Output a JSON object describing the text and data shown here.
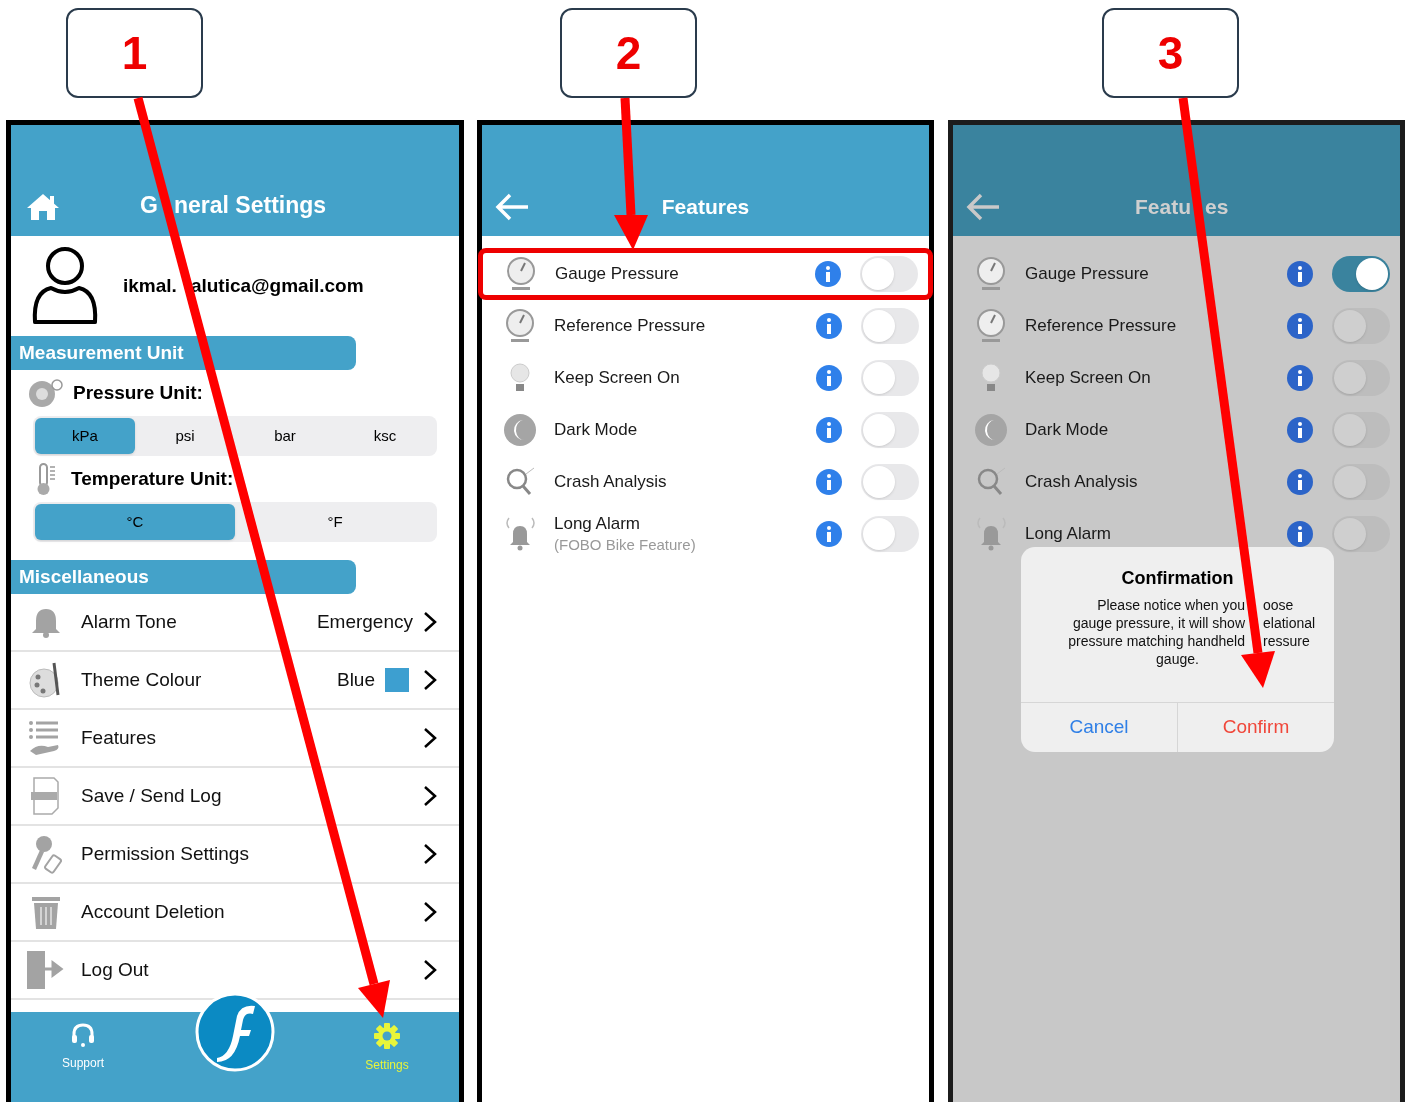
{
  "callouts": [
    {
      "label": "1"
    },
    {
      "label": "2"
    },
    {
      "label": "3"
    }
  ],
  "general_settings": {
    "title": [
      "G",
      "neral Settings"
    ],
    "email": [
      "ikmal.",
      "alutica@gmail.com"
    ],
    "measurement_header": "Measurement Unit",
    "pressure_label": "Pressure Unit:",
    "pressure_units": [
      {
        "label": "kPa",
        "selected": true
      },
      {
        "label": "psi",
        "selected": false
      },
      {
        "label": "bar",
        "selected": false
      },
      {
        "label": "ksc",
        "selected": false
      }
    ],
    "temperature_label": "Temperature Unit:",
    "temperature_units": [
      {
        "label": "°C",
        "selected": true
      },
      {
        "label": "°F",
        "selected": false
      }
    ],
    "misc_header": "Miscellaneous",
    "menu": [
      {
        "label": "Alarm Tone",
        "value": "Emergency"
      },
      {
        "label": "Theme Colour",
        "value": "Blue",
        "color": "#3d9fd0"
      },
      {
        "label": "Features"
      },
      {
        "label": "Save / Send Log"
      },
      {
        "label": "Permission Settings"
      },
      {
        "label": "Account Deletion"
      },
      {
        "label": "Log Out"
      }
    ],
    "tab_bar": [
      {
        "label": "Support",
        "selected": false
      },
      {
        "label": "Settings",
        "selected": true
      }
    ]
  },
  "features": {
    "title": "Features",
    "items": [
      {
        "label": "Gauge Pressure",
        "on": false,
        "highlighted": true
      },
      {
        "label": "Reference Pressure",
        "on": false,
        "highlighted": false
      },
      {
        "label": "Keep Screen On",
        "on": false,
        "highlighted": false
      },
      {
        "label": "Dark Mode",
        "on": false,
        "highlighted": false
      },
      {
        "label": "Crash Analysis",
        "on": false,
        "highlighted": false
      },
      {
        "label": "Long Alarm",
        "sub": "(FOBO Bike Feature)",
        "on": false,
        "highlighted": false
      }
    ]
  },
  "features_confirm": {
    "title": [
      "Featu",
      "es"
    ],
    "items": [
      {
        "label": "Gauge Pressure",
        "on": true
      },
      {
        "label": "Reference Pressure",
        "on": false
      },
      {
        "label": "Keep Screen On",
        "on": false
      },
      {
        "label": "Dark Mode",
        "on": false
      },
      {
        "label": "Crash Analysis",
        "on": false
      },
      {
        "label": "Long Alarm",
        "on": false
      }
    ],
    "dialog": {
      "title": "Confirmation",
      "message_lines": [
        [
          "Please notice when you",
          "oose"
        ],
        [
          "gauge pressure, it will show",
          "elational"
        ],
        [
          "pressure matching handheld",
          "ressure"
        ],
        [
          "gauge."
        ]
      ],
      "buttons": [
        {
          "label": "Cancel",
          "kind": "cancel"
        },
        {
          "label": "Confirm",
          "kind": "confirm"
        }
      ]
    }
  }
}
